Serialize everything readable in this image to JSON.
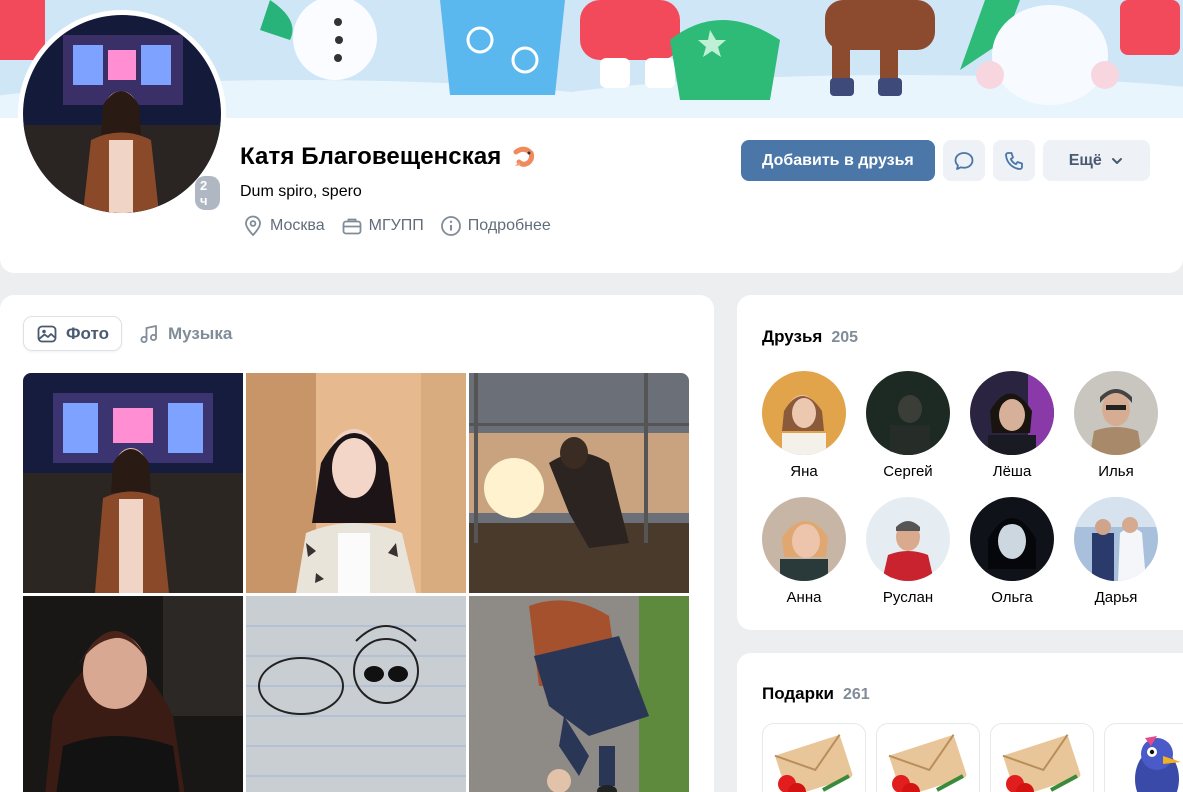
{
  "profile": {
    "name": "Катя Благовещенская",
    "status": "Dum spiro, spero",
    "online_badge": "2 ч",
    "info": [
      {
        "icon": "location-icon",
        "label": "Москва"
      },
      {
        "icon": "briefcase-icon",
        "label": "МГУПП"
      },
      {
        "icon": "info-icon",
        "label": "Подробнее"
      }
    ]
  },
  "actions": {
    "add_friend": "Добавить в друзья",
    "more": "Ещё"
  },
  "tabs": {
    "photos": "Фото",
    "music": "Музыка"
  },
  "friends": {
    "title": "Друзья",
    "count": "205",
    "list": [
      "Яна",
      "Сергей",
      "Лёша",
      "Илья",
      "Анна",
      "Руслан",
      "Ольга",
      "Дарья"
    ]
  },
  "gifts": {
    "title": "Подарки",
    "count": "261"
  },
  "colors": {
    "accent": "#4a76a8",
    "background": "#edeef0",
    "secondary_text": "#818c99"
  }
}
